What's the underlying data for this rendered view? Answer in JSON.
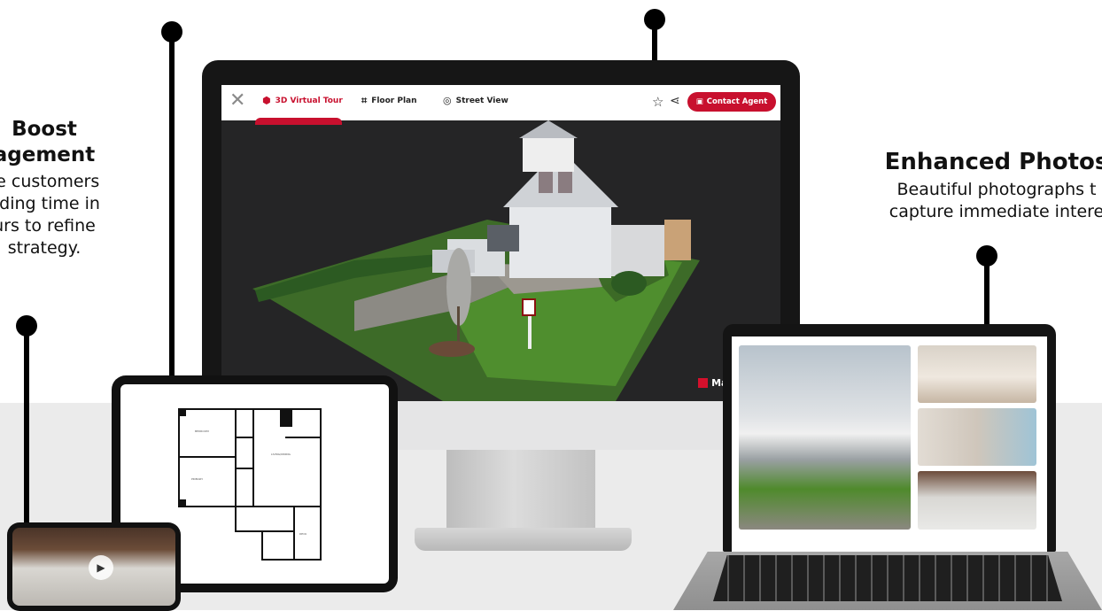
{
  "left_feature": {
    "title_line1": "Boost",
    "title_line2": "agement",
    "desc_lines": [
      "re customers",
      "nding time in",
      "urs to refine",
      "strategy."
    ]
  },
  "right_feature": {
    "title": "Enhanced Photos",
    "desc_lines": [
      "Beautiful photographs t",
      "capture immediate intere"
    ]
  },
  "tour_ui": {
    "tabs": [
      {
        "label": "3D Virtual Tour",
        "icon": "cube-icon",
        "active": true
      },
      {
        "label": "Floor Plan",
        "icon": "floor-plan-icon",
        "active": false
      },
      {
        "label": "Street View",
        "icon": "location-pin-icon",
        "active": false
      }
    ],
    "contact_label": "Contact Agent",
    "brand": "Matterport",
    "accent": "#c8102e"
  }
}
